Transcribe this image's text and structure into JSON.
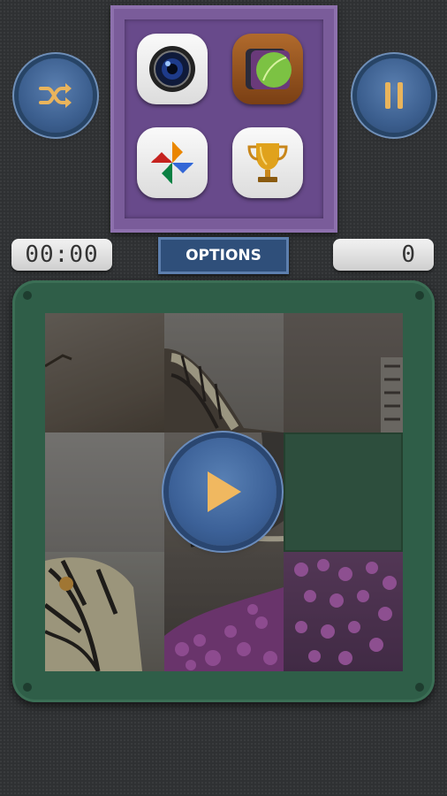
{
  "header": {
    "shuffle_icon": "shuffle-icon",
    "pause_icon": "pause-icon"
  },
  "menu": {
    "apps": [
      {
        "name": "camera",
        "icon": "camera-lens-icon"
      },
      {
        "name": "gallery",
        "icon": "leaf-gallery-icon"
      },
      {
        "name": "photos",
        "icon": "pinwheel-photos-icon"
      },
      {
        "name": "trophy",
        "icon": "trophy-icon"
      }
    ]
  },
  "status": {
    "timer": "00:00",
    "options_label": "OPTIONS",
    "moves": "0"
  },
  "puzzle": {
    "grid": "3x3",
    "empty_tile": 6,
    "play_icon": "play-icon"
  },
  "colors": {
    "accent": "#3c6198",
    "menu": "#7a5c9a",
    "board": "#2f5e48",
    "play_triangle": "#f0b860"
  }
}
